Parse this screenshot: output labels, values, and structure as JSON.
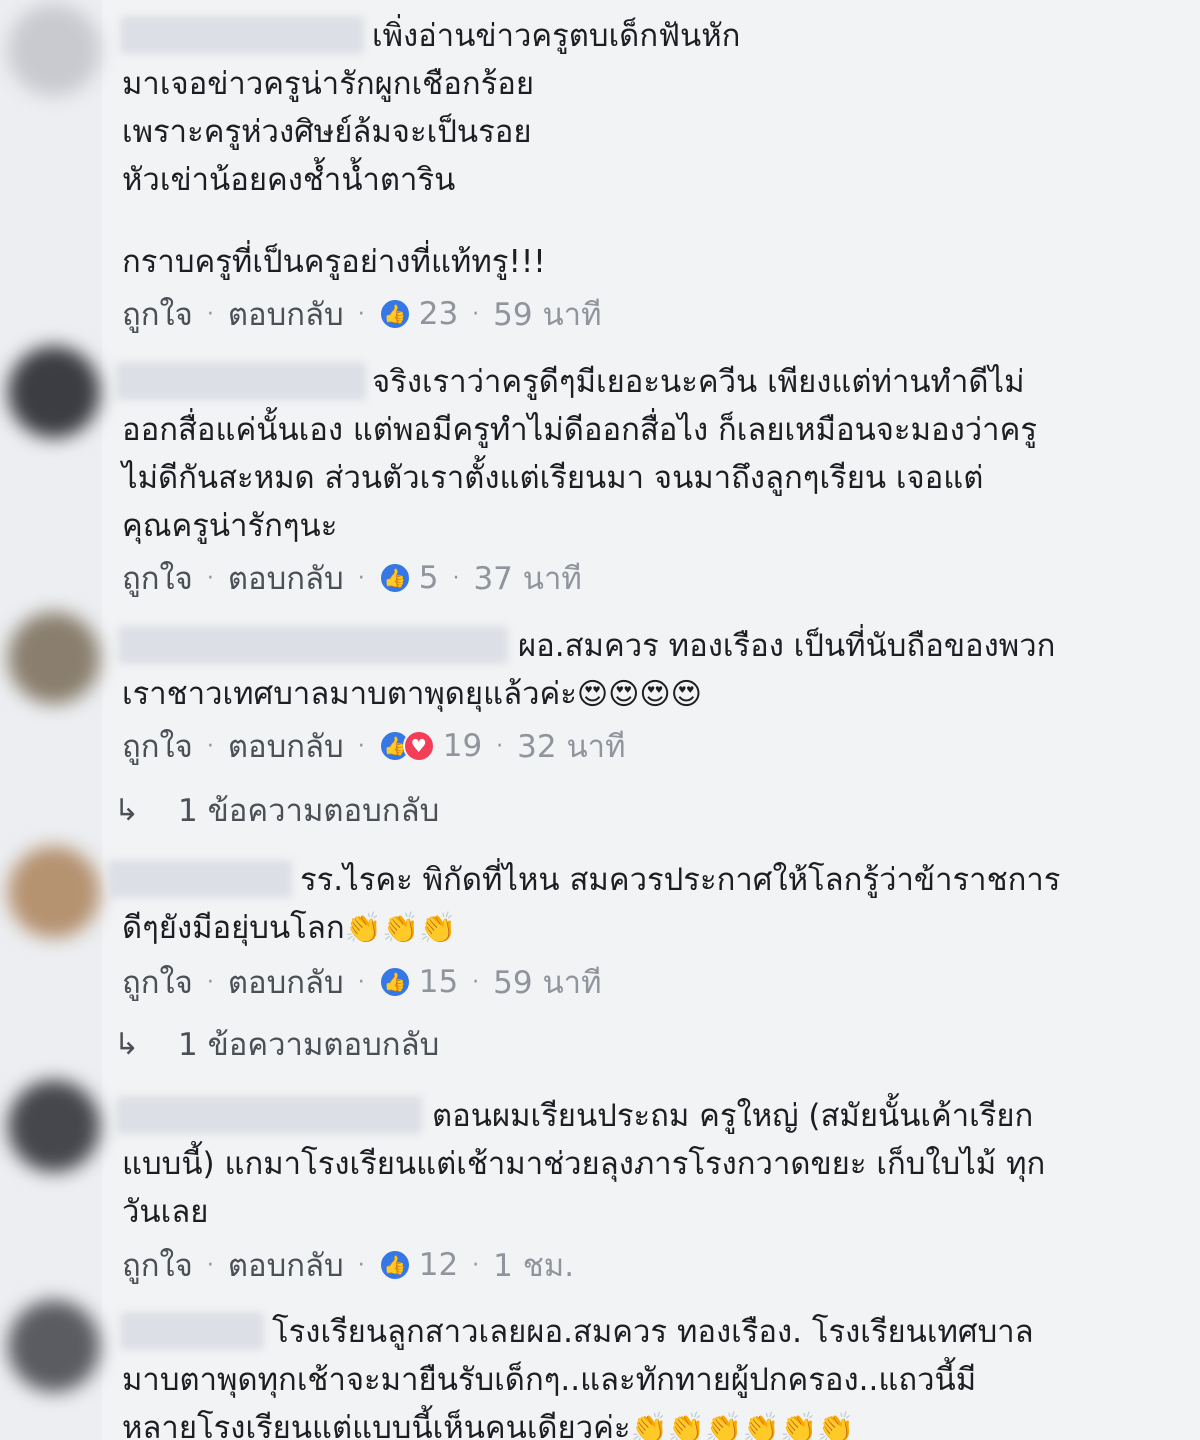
{
  "actions": {
    "like": "ถูกใจ",
    "reply": "ตอบกลับ",
    "separator": "·"
  },
  "colors": {
    "background": "#f2f3f5",
    "text": "#1c1e21",
    "muted": "#90949c",
    "link": "#4b4f56",
    "like_blue": "#3578e5",
    "love_red": "#f33e58"
  },
  "comments": [
    {
      "lines": [
        "เพิ่งอ่านข่าวครูตบเด็กฟันหัก",
        "มาเจอข่าวครูน่ารักผูกเชือกร้อย",
        "เพราะครูห่วงศิษย์ล้มจะเป็นรอย",
        "หัวเข่าน้อยคงช้ำน้ำตาริน",
        "กราบครูที่เป็นครูอย่างที่แท้ทรู!!!"
      ],
      "reactions": [
        "like"
      ],
      "count": "23",
      "time": "59 นาที"
    },
    {
      "lines": [
        "จริงเราว่าครูดีๆมีเยอะนะควีน เพียงแต่ท่านทำดีไม่",
        "ออกสื่อแค่นั้นเอง แต่พอมีครูทำไม่ดีออกสื่อไง ก็เลยเหมือนจะมองว่าครู",
        "ไม่ดีกันสะหมด ส่วนตัวเราตั้งแต่เรียนมา จนมาถึงลูกๆเรียน เจอแต่",
        "คุณครูน่ารักๆนะ"
      ],
      "reactions": [
        "like"
      ],
      "count": "5",
      "time": "37 นาที"
    },
    {
      "lines": [
        "ผอ.สมควร ทองเรือง เป็นที่นับถือของพวก",
        "เราชาวเทศบาลมาบตาพุดยุแล้วค่ะ"
      ],
      "emojis": "😍😍😍😍",
      "reactions": [
        "like",
        "love"
      ],
      "count": "19",
      "time": "32 นาที",
      "replies": "1 ข้อความตอบกลับ"
    },
    {
      "lines": [
        "รร.ไรคะ พิกัดที่ไหน สมควรประกาศให้โลกรู้ว่าข้าราชการ",
        "ดีๆยังมีอยุ่บนโลก"
      ],
      "emojis": "👏👏👏",
      "reactions": [
        "like"
      ],
      "count": "15",
      "time": "59 นาที",
      "replies": "1 ข้อความตอบกลับ"
    },
    {
      "lines": [
        "ตอนผมเรียนประถม ครูใหญ่ (สมัยนั้นเค้าเรียก",
        "แบบนี้) แกมาโรงเรียนแต่เช้ามาช่วยลุงภารโรงกวาดขยะ เก็บใบไม้ ทุก",
        "วันเลย"
      ],
      "reactions": [
        "like"
      ],
      "count": "12",
      "time": "1 ชม."
    },
    {
      "lines": [
        "โรงเรียนลูกสาวเลยผอ.สมควร ทองเรือง. โรงเรียนเทศบาล",
        "มาบตาพุดทุกเช้าจะมายืนรับเด็กๆ..และทักทายผู้ปกครอง..แถวนี้มี",
        "หลายโรงเรียนแต่แบบนี้เห็นคนเดียวค่ะ"
      ],
      "emojis": "👏👏👏👏👏👏"
    }
  ]
}
